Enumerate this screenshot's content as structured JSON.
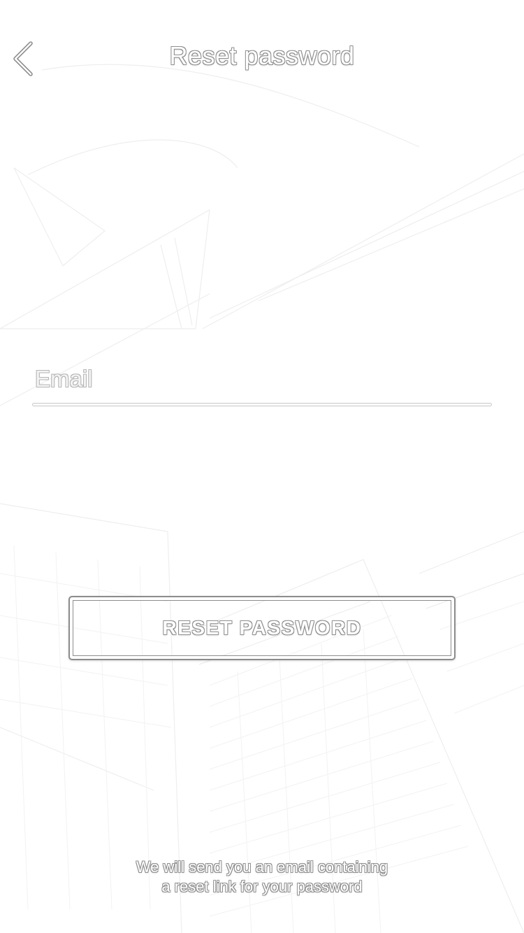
{
  "header": {
    "title": "Reset password",
    "back_icon": "chevron-left-icon"
  },
  "form": {
    "email_placeholder": "Email",
    "email_value": ""
  },
  "actions": {
    "reset_label": "RESET PASSWORD"
  },
  "footer": {
    "line1": "We will send you an email containing",
    "line2": "a reset link for your password"
  },
  "colors": {
    "background": "#ffffff",
    "outline": "#8f8f8f"
  }
}
